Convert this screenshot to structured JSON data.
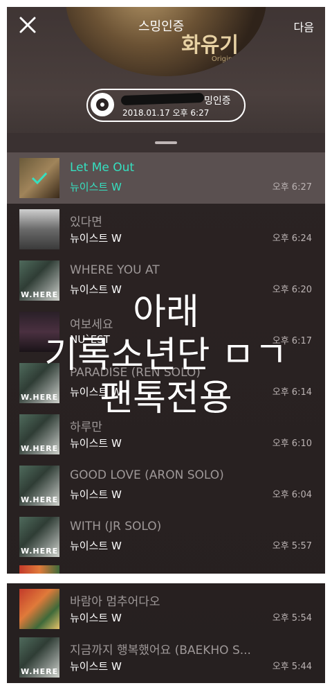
{
  "header": {
    "title": "스밍인증",
    "next_label": "다음",
    "cover_text": "화유기",
    "cover_sub": "Original",
    "badge_label": "밍인증",
    "badge_date": "2018.01.17 오후 6:27"
  },
  "tracks": [
    {
      "title": "Let Me Out",
      "artist": "뉴이스트 W",
      "time": "오후 6:27",
      "selected": true
    },
    {
      "title": "있다면",
      "artist": "뉴이스트 W",
      "time": "오후 6:24"
    },
    {
      "title": "WHERE YOU AT",
      "artist": "뉴이스트 W",
      "time": "오후 6:20"
    },
    {
      "title": "여보세요",
      "artist": "NU`EST",
      "time": "오후 6:17"
    },
    {
      "title": "PARADISE (REN SOLO)",
      "artist": "뉴이스트 W",
      "time": "오후 6:14"
    },
    {
      "title": "하루만",
      "artist": "뉴이스트 W",
      "time": "오후 6:10"
    },
    {
      "title": "GOOD LOVE (ARON SOLO)",
      "artist": "뉴이스트 W",
      "time": "오후 6:04"
    },
    {
      "title": "WITH (JR SOLO)",
      "artist": "뉴이스트 W",
      "time": "오후 5:57"
    },
    {
      "title": "바람아 멈추어다오",
      "artist": "뉴이스트 W",
      "time": "오후 5:54"
    },
    {
      "title": "지금까지 행복했어요 (BAEKHO S...",
      "artist": "뉴이스트 W",
      "time": "오후 5:44"
    }
  ],
  "album_art_text": "W.HERE",
  "overlay": {
    "line1": "아래",
    "line2": "기록소년단 ㅁㄱ",
    "line3": "팬톡전용"
  },
  "colors": {
    "accent": "#35e0c0",
    "background": "#2a2222"
  }
}
